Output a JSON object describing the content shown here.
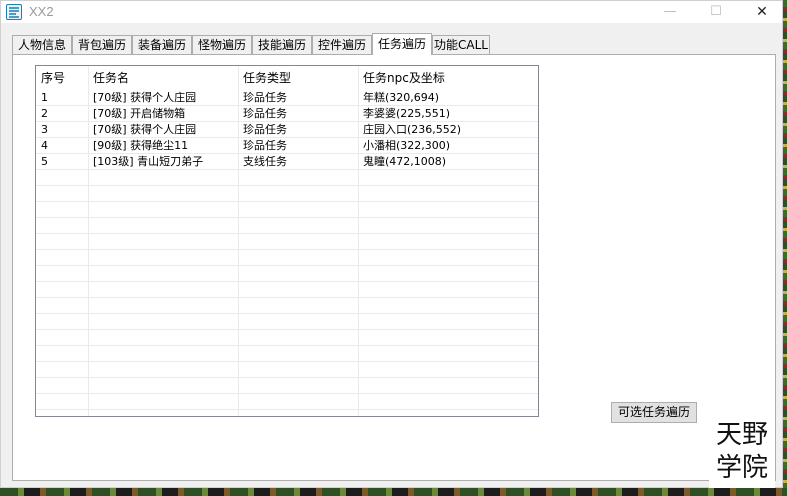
{
  "window": {
    "title": "XX2",
    "min_glyph": "—",
    "max_glyph": "☐",
    "close_glyph": "✕"
  },
  "tabs": [
    {
      "label": "人物信息",
      "active": false
    },
    {
      "label": "背包遍历",
      "active": false
    },
    {
      "label": "装备遍历",
      "active": false
    },
    {
      "label": "怪物遍历",
      "active": false
    },
    {
      "label": "技能遍历",
      "active": false
    },
    {
      "label": "控件遍历",
      "active": false
    },
    {
      "label": "任务遍历",
      "active": true
    },
    {
      "label": "功能CALL",
      "active": false
    }
  ],
  "quest_table": {
    "headers": [
      "序号",
      "任务名",
      "任务类型",
      "任务npc及坐标"
    ],
    "rows": [
      [
        "1",
        "[70级] 获得个人庄园",
        "珍品任务",
        "年糕(320,694)"
      ],
      [
        "2",
        "[70级] 开启储物箱",
        "珍品任务",
        "李婆婆(225,551)"
      ],
      [
        "3",
        "[70级] 获得个人庄园",
        "珍品任务",
        "庄园入口(236,552)"
      ],
      [
        "4",
        "[90级] 获得绝尘11",
        "珍品任务",
        "小潘相(322,300)"
      ],
      [
        "5",
        "[103级] 青山短刀弟子",
        "支线任务",
        "鬼瞳(472,1008)"
      ]
    ]
  },
  "buttons": {
    "traverse_optional": "可选任务遍历"
  },
  "watermark": {
    "line1": "天野",
    "line2": "学院"
  }
}
